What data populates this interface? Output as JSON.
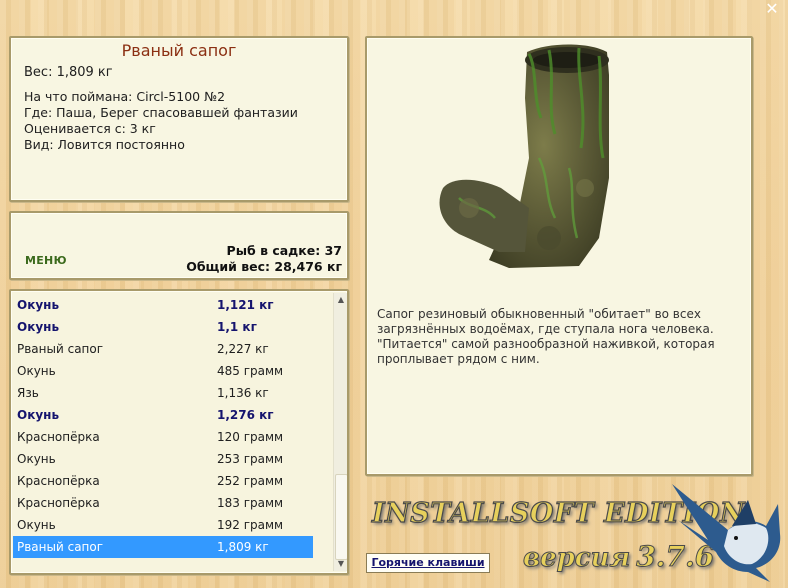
{
  "window": {
    "close_glyph": "✕"
  },
  "catch": {
    "title": "Рваный сапог",
    "weight": "Вес: 1,809 кг",
    "caught_on": "На что поймана: Circl-5100 №2",
    "where": "Где: Паша, Берег спасовавшей фантазии",
    "rated_from": "Оценивается с: 3 кг",
    "type": "Вид: Ловится постоянно"
  },
  "stats": {
    "menu_label": "МЕНЮ",
    "fish_in_keepnet": "Рыб в садке: 37",
    "total_weight": "Общий вес: 28,476 кг"
  },
  "fish_list": [
    {
      "name": "Окунь",
      "weight": "1,121 кг",
      "bold": true
    },
    {
      "name": "Окунь",
      "weight": "1,1 кг",
      "bold": true
    },
    {
      "name": "Рваный сапог",
      "weight": "2,227 кг",
      "bold": false
    },
    {
      "name": "Окунь",
      "weight": "485 грамм",
      "bold": false
    },
    {
      "name": "Язь",
      "weight": "1,136 кг",
      "bold": false
    },
    {
      "name": "Окунь",
      "weight": "1,276 кг",
      "bold": true
    },
    {
      "name": "Краснопёрка",
      "weight": "120 грамм",
      "bold": false
    },
    {
      "name": "Окунь",
      "weight": "253 грамм",
      "bold": false
    },
    {
      "name": "Краснопёрка",
      "weight": "252 грамм",
      "bold": false
    },
    {
      "name": "Краснопёрка",
      "weight": "183 грамм",
      "bold": false
    },
    {
      "name": "Окунь",
      "weight": "192 грамм",
      "bold": false
    },
    {
      "name": "Рваный сапог",
      "weight": "1,809 кг",
      "bold": false,
      "selected": true
    }
  ],
  "description": {
    "text": "Сапог резиновый обыкновенный \"обитает\" во всех загрязнённых водоёмах, где ступала нога человека. \"Питается\" самой разнообразной наживкой, которая проплывает рядом с ним."
  },
  "footer": {
    "hotkeys_label": "Горячие клавиши",
    "brand": "INSTALLSOFT EDITION",
    "version_word": "версия",
    "version_number": "3.7.6"
  },
  "colors": {
    "accent_title": "#8b2f12",
    "bold_fish": "#15146e",
    "selection": "#3399ff",
    "menu": "#3b6a1c"
  }
}
